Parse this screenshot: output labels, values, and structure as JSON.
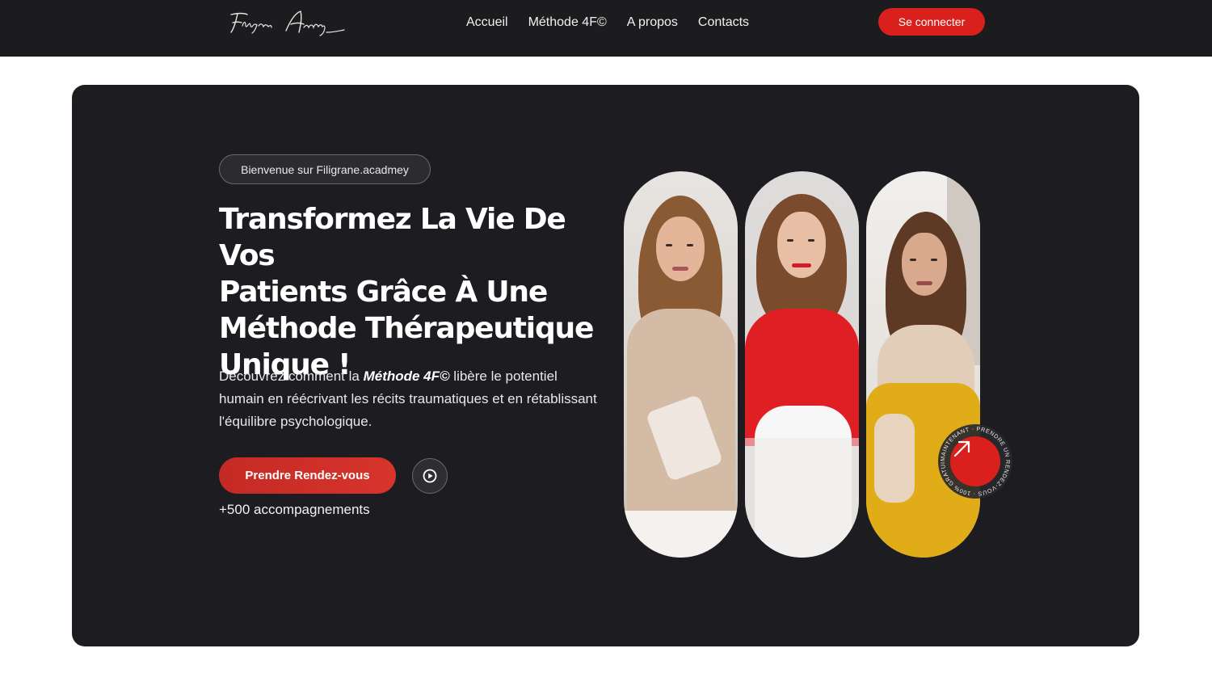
{
  "brand": {
    "logo_text": "Filigrane Academy"
  },
  "nav": {
    "items": [
      {
        "label": "Accueil"
      },
      {
        "label": "Méthode 4F©"
      },
      {
        "label": "A propos"
      },
      {
        "label": "Contacts"
      }
    ],
    "login_label": "Se connecter"
  },
  "hero": {
    "welcome_pill": "Bienvenue sur Filigrane.acadmey",
    "headline": {
      "line1": "Transformez La Vie De Vos",
      "line2": "Patients Grâce À Une",
      "line3_underlined": "Méthode Thérapeutique",
      "line4": "Unique !"
    },
    "description": {
      "prefix": "Découvrez comment la ",
      "emphasis": "Méthode 4F©",
      "suffix": " libère le potentiel humain en réécrivant les récits traumatiques et en rétablissant l'équilibre psychologique."
    },
    "cta_label": "Prendre Rendez-vous",
    "play_icon": "play-circle-icon",
    "accompaniments": "+500 accompagnements",
    "badge": {
      "circular_text": "MAINTENANT · PRENDRE UN RENDEZ-VOUS · 100% GRATUIT ·",
      "icon": "arrow-up-right-icon"
    }
  },
  "colors": {
    "nav_bg": "#1c1c1f",
    "hero_bg": "#1d1c21",
    "accent_red": "#d9201c",
    "underline_gold": "#e9cf9a"
  }
}
